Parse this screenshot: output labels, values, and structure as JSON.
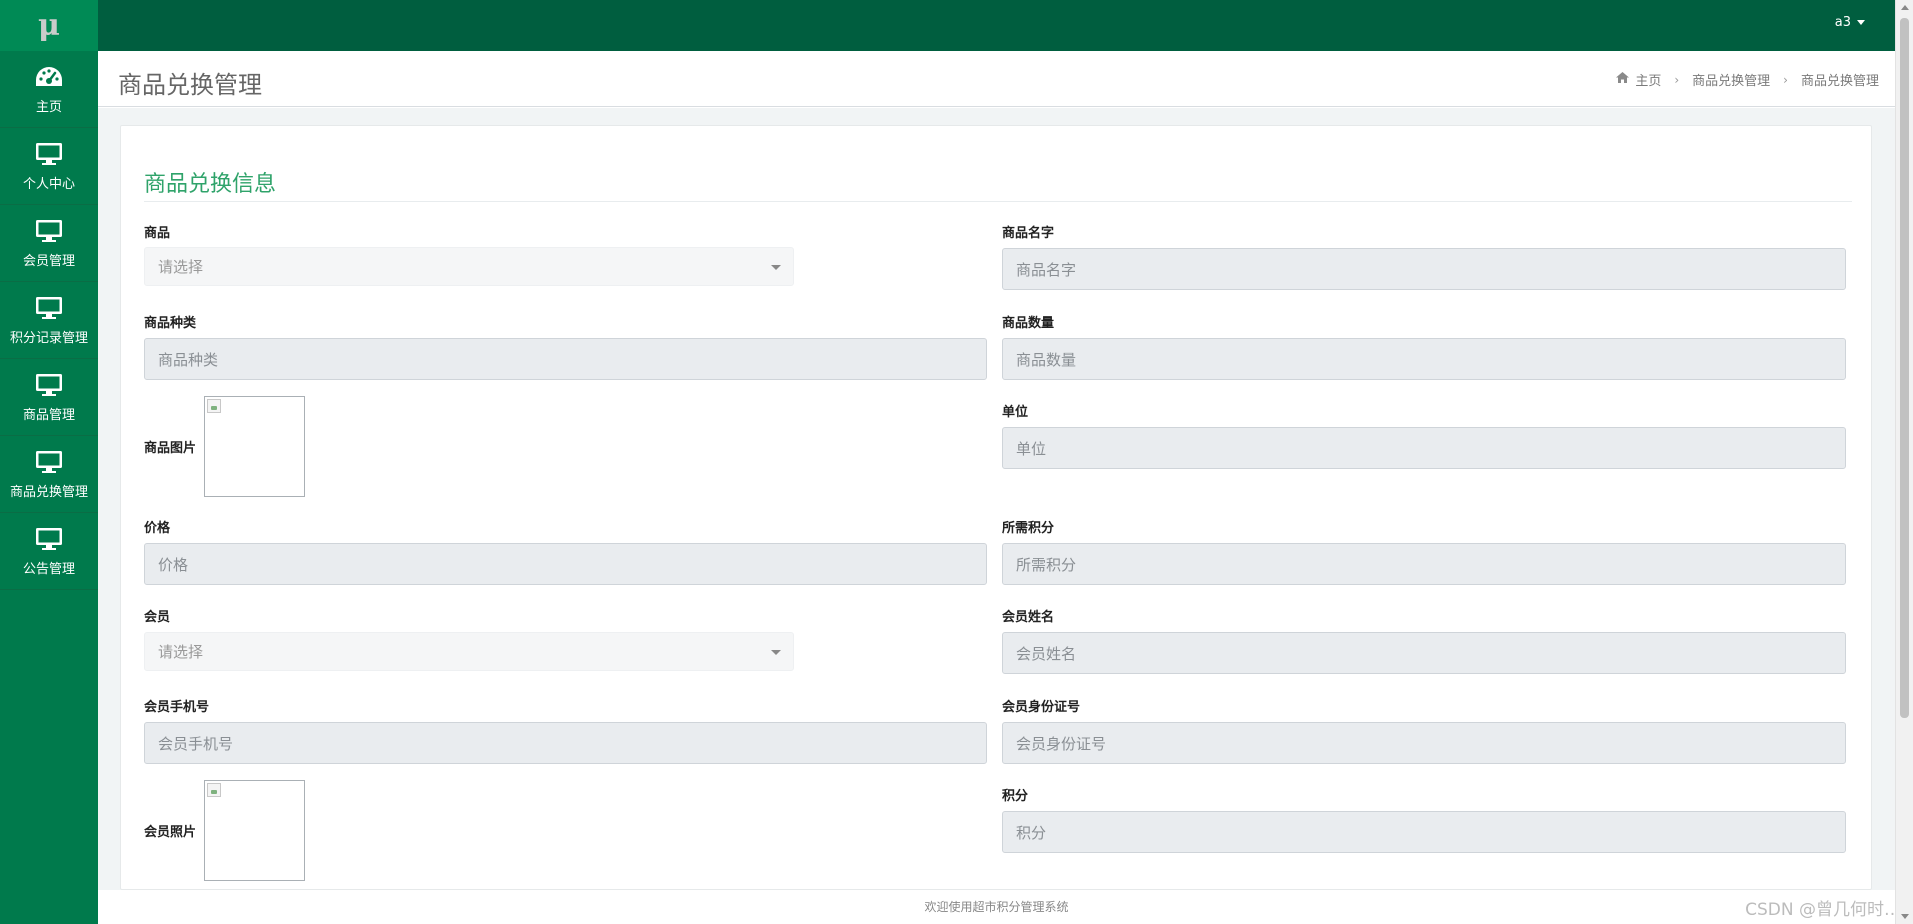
{
  "app": {
    "logo_text": "μ",
    "user": "a3"
  },
  "sidebar": {
    "items": [
      {
        "label": "主页",
        "icon": "dashboard-icon"
      },
      {
        "label": "个人中心",
        "icon": "monitor-icon"
      },
      {
        "label": "会员管理",
        "icon": "monitor-icon"
      },
      {
        "label": "积分记录管理",
        "icon": "monitor-icon"
      },
      {
        "label": "商品管理",
        "icon": "monitor-icon"
      },
      {
        "label": "商品兑换管理",
        "icon": "monitor-icon"
      },
      {
        "label": "公告管理",
        "icon": "monitor-icon"
      }
    ]
  },
  "header": {
    "title": "商品兑换管理",
    "breadcrumb": [
      "主页",
      "商品兑换管理",
      "商品兑换管理"
    ]
  },
  "form": {
    "section_title": "商品兑换信息",
    "fields": {
      "goods": {
        "label": "商品",
        "placeholder": "请选择"
      },
      "goods_name": {
        "label": "商品名字",
        "placeholder": "商品名字"
      },
      "goods_type": {
        "label": "商品种类",
        "placeholder": "商品种类"
      },
      "goods_qty": {
        "label": "商品数量",
        "placeholder": "商品数量"
      },
      "goods_image": {
        "label": "商品图片"
      },
      "unit": {
        "label": "单位",
        "placeholder": "单位"
      },
      "price": {
        "label": "价格",
        "placeholder": "价格"
      },
      "points_needed": {
        "label": "所需积分",
        "placeholder": "所需积分"
      },
      "member": {
        "label": "会员",
        "placeholder": "请选择"
      },
      "member_name": {
        "label": "会员姓名",
        "placeholder": "会员姓名"
      },
      "member_phone": {
        "label": "会员手机号",
        "placeholder": "会员手机号"
      },
      "member_id": {
        "label": "会员身份证号",
        "placeholder": "会员身份证号"
      },
      "member_photo": {
        "label": "会员照片"
      },
      "points": {
        "label": "积分",
        "placeholder": "积分"
      }
    }
  },
  "footer": {
    "text": "欢迎使用超市积分管理系统",
    "watermark": "CSDN @曾几何时…"
  },
  "colors": {
    "sidebar": "#007a4c",
    "topbar": "#005e3f",
    "accent": "#2fa36a"
  }
}
